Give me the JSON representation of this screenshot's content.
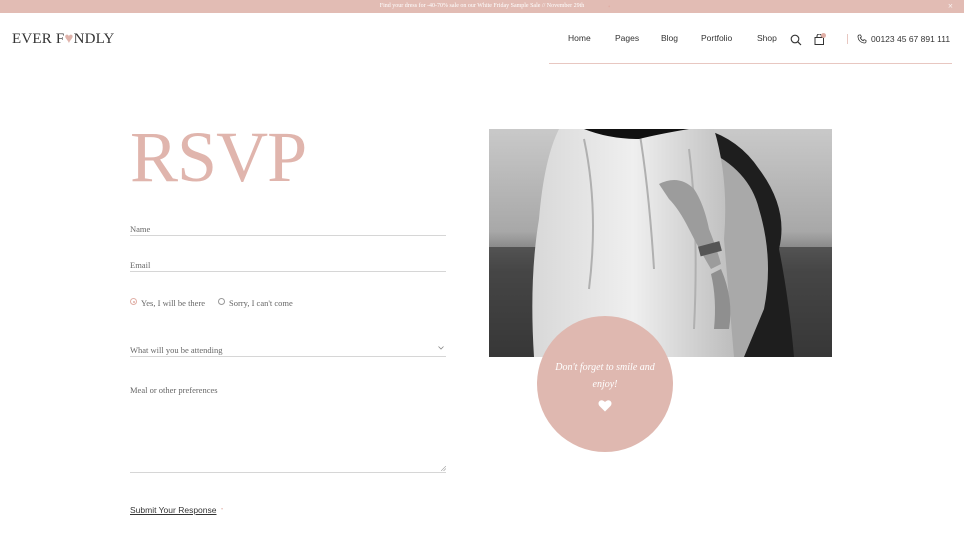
{
  "announcement": {
    "text": "Find your dress for -40-70% sale on our White Friday Sample Sale // November 29th",
    "close_icon": "×"
  },
  "logo": {
    "before": "EVER F",
    "heart": "♥",
    "after": "NDLY"
  },
  "nav": {
    "items": [
      "Home",
      "Pages",
      "Blog",
      "Portfolio",
      "Shop"
    ],
    "dot": "•",
    "phone": "00123 45 67 891 111"
  },
  "icons": {
    "search": "search-icon",
    "cart": "shopping-bag-icon",
    "phone": "phone-icon",
    "heart": "heart-icon"
  },
  "colors": {
    "accent": "#e0b5ad",
    "topbar": "#e2bcb4",
    "circle": "#dfb8b0"
  },
  "form": {
    "title": "RSVP",
    "name_label": "Name",
    "email_label": "Email",
    "radio_yes": "Yes, I will be there",
    "radio_no": "Sorry, I can't come",
    "attending_select": "What will you be attending",
    "preferences_label": "Meal or other preferences",
    "submit_label": "Submit Your Response",
    "submit_dot": "•"
  },
  "feature": {
    "circle_text": "Don't forget to smile and enjoy!"
  }
}
